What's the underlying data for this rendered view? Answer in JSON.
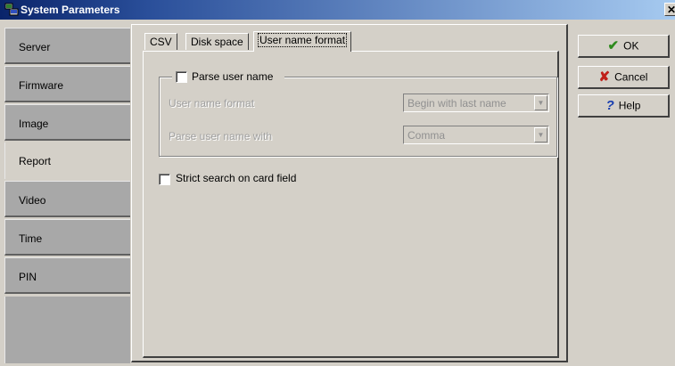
{
  "window": {
    "title": "System Parameters",
    "close_glyph": "✕"
  },
  "sidebar": {
    "items": [
      {
        "label": "Server",
        "active": false
      },
      {
        "label": "Firmware",
        "active": false
      },
      {
        "label": "Image",
        "active": false
      },
      {
        "label": "Report",
        "active": true
      },
      {
        "label": "Video",
        "active": false
      },
      {
        "label": "Time",
        "active": false
      },
      {
        "label": "PIN",
        "active": false
      }
    ]
  },
  "tabs": [
    {
      "label": "CSV",
      "active": false
    },
    {
      "label": "Disk space",
      "active": false
    },
    {
      "label": "User name format",
      "active": true
    }
  ],
  "parse_group": {
    "checkbox_label": "Parse user name",
    "checked": false,
    "format_label": "User name format",
    "format_value": "Begin with last name",
    "separator_label": "Parse user name with",
    "separator_value": "Comma"
  },
  "strict_search": {
    "label": "Strict search on card field",
    "checked": false
  },
  "buttons": {
    "ok": {
      "label": "OK",
      "icon": "checkmark-icon",
      "glyph": "✔",
      "color": "#2e8b1e"
    },
    "cancel": {
      "label": "Cancel",
      "icon": "x-icon",
      "glyph": "✘",
      "color": "#c0201a"
    },
    "help": {
      "label": "Help",
      "icon": "question-icon",
      "glyph": "?",
      "color": "#1a3fb0"
    }
  },
  "colors": {
    "titlebar": "#0a246a",
    "face": "#d4d0c8",
    "side_tab": "#a8a8a8"
  }
}
